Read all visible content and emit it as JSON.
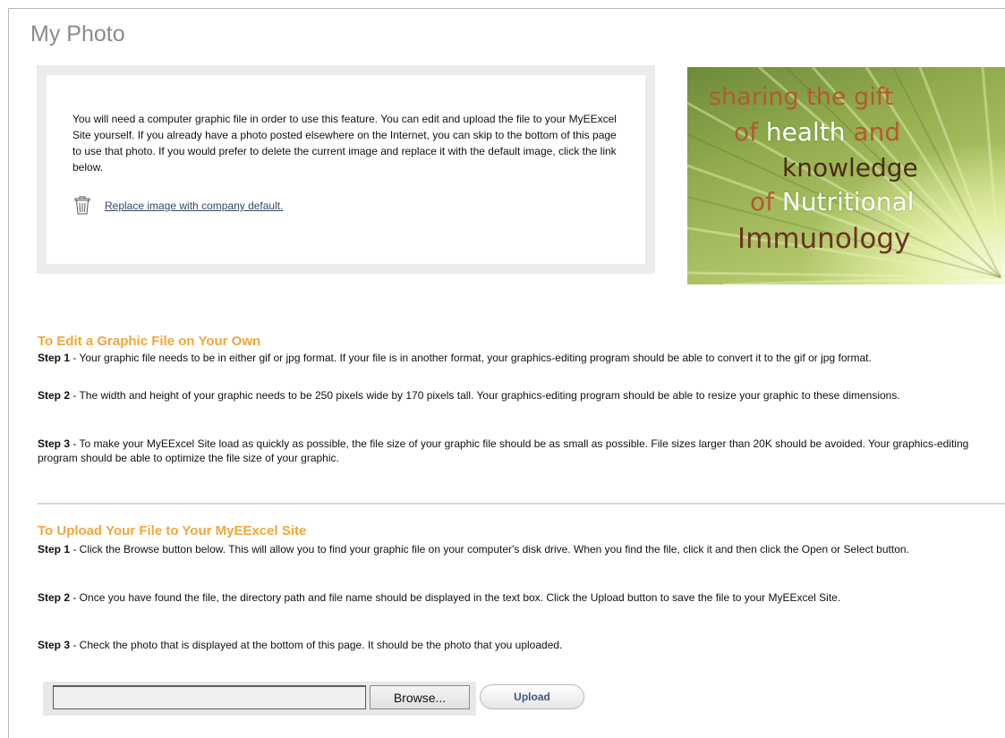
{
  "page": {
    "title": "My Photo"
  },
  "notice": {
    "text": "You will need a computer graphic file in order to use this feature. You can edit and upload the file to your MyEExcel Site yourself. If you already have a photo posted elsewhere on the Internet, you can skip to the bottom of this page to use that photo. If you would prefer to delete the current image and replace it with the default image, click the link below.",
    "replace_link": "Replace image with company default."
  },
  "banner": {
    "line1": "sharing the gift",
    "line2_pre": "of ",
    "line2_bold": "health",
    "line2_post": " and",
    "line3": "knowledge",
    "line4_pre": "of ",
    "line4_post": "Nutritional",
    "line5": "Immunology"
  },
  "edit_section": {
    "heading": "To Edit a Graphic File on Your Own",
    "steps": [
      {
        "label": "Step 1",
        "text": " - Your graphic file needs to be in either gif or jpg format. If your file is in another format, your graphics-editing program should be able to convert it to the gif or jpg format."
      },
      {
        "label": "Step 2",
        "text": " - The width and height of your graphic needs to be 250 pixels wide by 170 pixels tall. Your graphics-editing program should be able to resize your graphic to these dimensions."
      },
      {
        "label": "Step 3",
        "text": " - To make your MyEExcel Site load as quickly as possible, the file size of your graphic file should be as small as possible. File sizes larger than 20K should be avoided. Your graphics-editing program should be able to optimize the file size of your graphic."
      }
    ]
  },
  "upload_section": {
    "heading": "To Upload Your File to Your MyEExcel Site",
    "steps": [
      {
        "label": "Step 1",
        "text": " - Click the Browse button below. This will allow you to find your graphic file on your computer's disk drive. When you find the file, click it and then click the Open or Select button."
      },
      {
        "label": "Step 2",
        "text": " - Once you have found the file, the directory path and file name should be displayed in the text box. Click the Upload button to save the file to your MyEExcel Site."
      },
      {
        "label": "Step 3",
        "text": " - Check the photo that is displayed at the bottom of this page. It should be the photo that you uploaded."
      }
    ]
  },
  "upload_controls": {
    "file_value": "",
    "browse_label": "Browse...",
    "upload_label": "Upload"
  }
}
